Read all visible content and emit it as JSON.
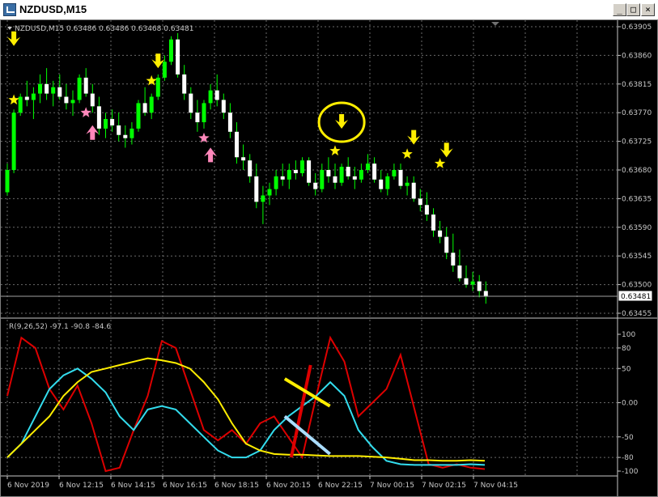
{
  "window": {
    "title": "NZDUSD,M15",
    "buttons": [
      "_",
      "□",
      "×"
    ]
  },
  "main_chart": {
    "header": "NZDUSD,M15  0.63486 0.63486 0.63468 0.63481",
    "price_axis": [
      "0.63905",
      "0.63860",
      "0.63815",
      "0.63770",
      "0.63725",
      "0.63680",
      "0.63635",
      "0.63590",
      "0.63545",
      "0.63500",
      "0.63455"
    ],
    "current_price_label": "0.63481"
  },
  "indicator": {
    "header": "R(9,26,52) -97.1 -90.8 -84.6",
    "axis": [
      "100",
      "80",
      "50",
      "0.00",
      "-50",
      "-80",
      "-100"
    ]
  },
  "time_axis": [
    "6 Nov 2019",
    "6 Nov 12:15",
    "6 Nov 14:15",
    "6 Nov 16:15",
    "6 Nov 18:15",
    "6 Nov 20:15",
    "6 Nov 22:15",
    "7 Nov 00:15",
    "7 Nov 02:15",
    "7 Nov 04:15"
  ],
  "colors": {
    "bull": "#00ff00",
    "bear": "#ffffff",
    "arrow_down": "#ffee00",
    "arrow_up": "#ff88bb",
    "red": "#dd0000",
    "cyan": "#33ddee",
    "yellow": "#ffee00"
  },
  "chart_data": {
    "type": "candlestick",
    "symbol": "NZDUSD",
    "timeframe": "M15",
    "ohlc": [
      [
        0.63645,
        0.6369,
        0.6364,
        0.6368
      ],
      [
        0.6368,
        0.63775,
        0.63675,
        0.6377
      ],
      [
        0.6377,
        0.638,
        0.63765,
        0.63795
      ],
      [
        0.63795,
        0.6382,
        0.6378,
        0.6379
      ],
      [
        0.6379,
        0.6381,
        0.6376,
        0.638
      ],
      [
        0.638,
        0.6383,
        0.63785,
        0.63815
      ],
      [
        0.63815,
        0.6384,
        0.6379,
        0.638
      ],
      [
        0.638,
        0.6382,
        0.6378,
        0.6381
      ],
      [
        0.6381,
        0.6383,
        0.6379,
        0.63795
      ],
      [
        0.63795,
        0.63815,
        0.63775,
        0.63785
      ],
      [
        0.63785,
        0.63805,
        0.63765,
        0.6379
      ],
      [
        0.6379,
        0.6383,
        0.63785,
        0.63825
      ],
      [
        0.63825,
        0.6384,
        0.63795,
        0.638
      ],
      [
        0.638,
        0.63815,
        0.6377,
        0.6378
      ],
      [
        0.6378,
        0.63795,
        0.63735,
        0.63745
      ],
      [
        0.63745,
        0.6377,
        0.6373,
        0.6376
      ],
      [
        0.6376,
        0.63775,
        0.6374,
        0.6375
      ],
      [
        0.6375,
        0.6377,
        0.63725,
        0.63735
      ],
      [
        0.63735,
        0.6375,
        0.63715,
        0.6373
      ],
      [
        0.6373,
        0.63755,
        0.6372,
        0.63745
      ],
      [
        0.63745,
        0.6379,
        0.6374,
        0.63785
      ],
      [
        0.63785,
        0.6381,
        0.63765,
        0.6377
      ],
      [
        0.6377,
        0.638,
        0.6376,
        0.63795
      ],
      [
        0.63795,
        0.6383,
        0.6379,
        0.63825
      ],
      [
        0.63825,
        0.6386,
        0.6382,
        0.6385
      ],
      [
        0.6385,
        0.6389,
        0.63845,
        0.63885
      ],
      [
        0.63885,
        0.63895,
        0.63825,
        0.6383
      ],
      [
        0.6383,
        0.63845,
        0.6379,
        0.638
      ],
      [
        0.638,
        0.6381,
        0.6376,
        0.6377
      ],
      [
        0.6377,
        0.6379,
        0.6374,
        0.63755
      ],
      [
        0.63755,
        0.6379,
        0.63745,
        0.63785
      ],
      [
        0.63785,
        0.63815,
        0.63775,
        0.63805
      ],
      [
        0.63805,
        0.6383,
        0.6378,
        0.6379
      ],
      [
        0.6379,
        0.638,
        0.6376,
        0.6377
      ],
      [
        0.6377,
        0.63785,
        0.6373,
        0.6374
      ],
      [
        0.6374,
        0.63755,
        0.6369,
        0.637
      ],
      [
        0.637,
        0.6372,
        0.6368,
        0.63695
      ],
      [
        0.63695,
        0.63705,
        0.6366,
        0.6367
      ],
      [
        0.6367,
        0.6369,
        0.6362,
        0.6363
      ],
      [
        0.6363,
        0.63655,
        0.63595,
        0.6364
      ],
      [
        0.6364,
        0.6366,
        0.63625,
        0.6365
      ],
      [
        0.6365,
        0.6368,
        0.6364,
        0.6367
      ],
      [
        0.6367,
        0.6369,
        0.63655,
        0.63665
      ],
      [
        0.63665,
        0.6369,
        0.6365,
        0.6368
      ],
      [
        0.6368,
        0.63695,
        0.63665,
        0.63675
      ],
      [
        0.63675,
        0.637,
        0.6367,
        0.63695
      ],
      [
        0.63695,
        0.637,
        0.63655,
        0.6366
      ],
      [
        0.6366,
        0.63675,
        0.6364,
        0.6365
      ],
      [
        0.6365,
        0.6369,
        0.63645,
        0.6368
      ],
      [
        0.6368,
        0.637,
        0.6366,
        0.6367
      ],
      [
        0.6367,
        0.6369,
        0.6365,
        0.6366
      ],
      [
        0.6366,
        0.6369,
        0.63655,
        0.63685
      ],
      [
        0.63685,
        0.637,
        0.63665,
        0.6367
      ],
      [
        0.6367,
        0.63685,
        0.6365,
        0.63665
      ],
      [
        0.63665,
        0.6369,
        0.6366,
        0.6368
      ],
      [
        0.6368,
        0.63705,
        0.63675,
        0.6369
      ],
      [
        0.6369,
        0.637,
        0.6366,
        0.63665
      ],
      [
        0.63665,
        0.6368,
        0.63645,
        0.6365
      ],
      [
        0.6365,
        0.63675,
        0.6364,
        0.6367
      ],
      [
        0.6367,
        0.6369,
        0.63665,
        0.6368
      ],
      [
        0.6368,
        0.6369,
        0.6365,
        0.63655
      ],
      [
        0.63655,
        0.6367,
        0.6364,
        0.6366
      ],
      [
        0.6366,
        0.6367,
        0.6363,
        0.63635
      ],
      [
        0.63635,
        0.6365,
        0.63615,
        0.63625
      ],
      [
        0.63625,
        0.63645,
        0.636,
        0.6361
      ],
      [
        0.6361,
        0.6362,
        0.63575,
        0.63585
      ],
      [
        0.63585,
        0.636,
        0.63565,
        0.63575
      ],
      [
        0.63575,
        0.6359,
        0.6354,
        0.6355
      ],
      [
        0.6355,
        0.6358,
        0.6352,
        0.6353
      ],
      [
        0.6353,
        0.63555,
        0.63505,
        0.6351
      ],
      [
        0.6351,
        0.6353,
        0.63495,
        0.635
      ],
      [
        0.635,
        0.6352,
        0.6349,
        0.63505
      ],
      [
        0.63505,
        0.63515,
        0.6348,
        0.6349
      ],
      [
        0.6349,
        0.63505,
        0.6347,
        0.63481
      ]
    ],
    "markers": [
      {
        "type": "down_arrow",
        "bar": 1,
        "price": 0.63885
      },
      {
        "type": "star_yellow",
        "bar": 1,
        "price": 0.6379
      },
      {
        "type": "down_arrow",
        "bar": 23,
        "price": 0.6385
      },
      {
        "type": "star_yellow",
        "bar": 22,
        "price": 0.6382
      },
      {
        "type": "star_pink",
        "bar": 12,
        "price": 0.6377
      },
      {
        "type": "up_arrow",
        "bar": 13,
        "price": 0.6374
      },
      {
        "type": "star_pink",
        "bar": 30,
        "price": 0.6373
      },
      {
        "type": "up_arrow",
        "bar": 31,
        "price": 0.63705
      },
      {
        "type": "down_arrow",
        "bar": 51,
        "price": 0.63755
      },
      {
        "type": "star_yellow",
        "bar": 50,
        "price": 0.6371
      },
      {
        "type": "down_arrow",
        "bar": 62,
        "price": 0.6373
      },
      {
        "type": "star_yellow",
        "bar": 61,
        "price": 0.63705
      },
      {
        "type": "down_arrow",
        "bar": 67,
        "price": 0.6371
      },
      {
        "type": "star_yellow",
        "bar": 66,
        "price": 0.6369
      }
    ],
    "indicator_series": [
      {
        "name": "R(9)",
        "color": "#dd0000",
        "values": [
          10,
          95,
          80,
          20,
          -10,
          25,
          -30,
          -100,
          -95,
          -40,
          10,
          90,
          80,
          20,
          -40,
          -55,
          -40,
          -60,
          -30,
          -20,
          -50,
          -80,
          10,
          95,
          60,
          -20,
          0,
          20,
          70,
          -10,
          -90,
          -95,
          -90,
          -95,
          -97
        ]
      },
      {
        "name": "R(26)",
        "color": "#33ddee",
        "values": [
          -80,
          -60,
          -20,
          20,
          40,
          50,
          35,
          15,
          -20,
          -40,
          -10,
          -5,
          -10,
          -30,
          -50,
          -70,
          -80,
          -80,
          -70,
          -40,
          -20,
          -5,
          10,
          30,
          10,
          -40,
          -65,
          -85,
          -90,
          -91,
          -91,
          -91,
          -91,
          -90,
          -91
        ]
      },
      {
        "name": "R(52)",
        "color": "#ffee00",
        "values": [
          -80,
          -60,
          -40,
          -20,
          10,
          30,
          45,
          50,
          55,
          60,
          65,
          62,
          58,
          50,
          30,
          5,
          -30,
          -60,
          -70,
          -75,
          -76,
          -76,
          -77,
          -78,
          -78,
          -78,
          -79,
          -80,
          -82,
          -84,
          -84,
          -85,
          -85,
          -84,
          -85
        ]
      }
    ],
    "annotations": [
      {
        "type": "circle",
        "bar": 51,
        "price": 0.63755
      },
      {
        "type": "trendline",
        "color": "#dd0000",
        "from": [
          44,
          -80
        ],
        "to": [
          47,
          55
        ]
      },
      {
        "type": "trendline",
        "color": "#ffee00",
        "from": [
          43,
          35
        ],
        "to": [
          50,
          -5
        ]
      },
      {
        "type": "trendline",
        "color": "#aaddff",
        "from": [
          43,
          -20
        ],
        "to": [
          50,
          -75
        ]
      }
    ]
  }
}
